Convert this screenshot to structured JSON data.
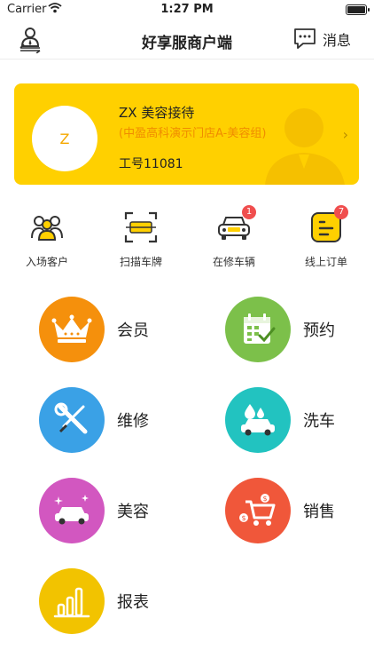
{
  "status_bar": {
    "carrier": "Carrier",
    "time": "1:27 PM"
  },
  "nav": {
    "title": "好享服商户端",
    "message_label": "消息"
  },
  "profile": {
    "avatar_letter": "Z",
    "name": "ZX  美容接待",
    "store": "(中盈高科演示门店A-美容组)",
    "job_no": "工号11081"
  },
  "quick_actions": [
    {
      "label": "入场客户",
      "icon": "customers-icon"
    },
    {
      "label": "扫描车牌",
      "icon": "scan-plate-icon"
    },
    {
      "label": "在修车辆",
      "icon": "car-icon",
      "badge": "1"
    },
    {
      "label": "线上订单",
      "icon": "order-icon",
      "badge": "7"
    }
  ],
  "features": [
    {
      "label": "会员",
      "icon": "crown-icon",
      "color": "#f5900c"
    },
    {
      "label": "预约",
      "icon": "calendar-check-icon",
      "color": "#7cc04a"
    },
    {
      "label": "维修",
      "icon": "wrench-screwdriver-icon",
      "color": "#3aa1e6"
    },
    {
      "label": "洗车",
      "icon": "car-wash-icon",
      "color": "#22c3c0"
    },
    {
      "label": "美容",
      "icon": "car-sparkle-icon",
      "color": "#d257c0"
    },
    {
      "label": "销售",
      "icon": "cart-icon",
      "color": "#f0573a"
    },
    {
      "label": "报表",
      "icon": "bar-chart-icon",
      "color": "#f2c300"
    }
  ],
  "colors": {
    "accent": "#ffd000",
    "badge": "#f04e4e"
  }
}
